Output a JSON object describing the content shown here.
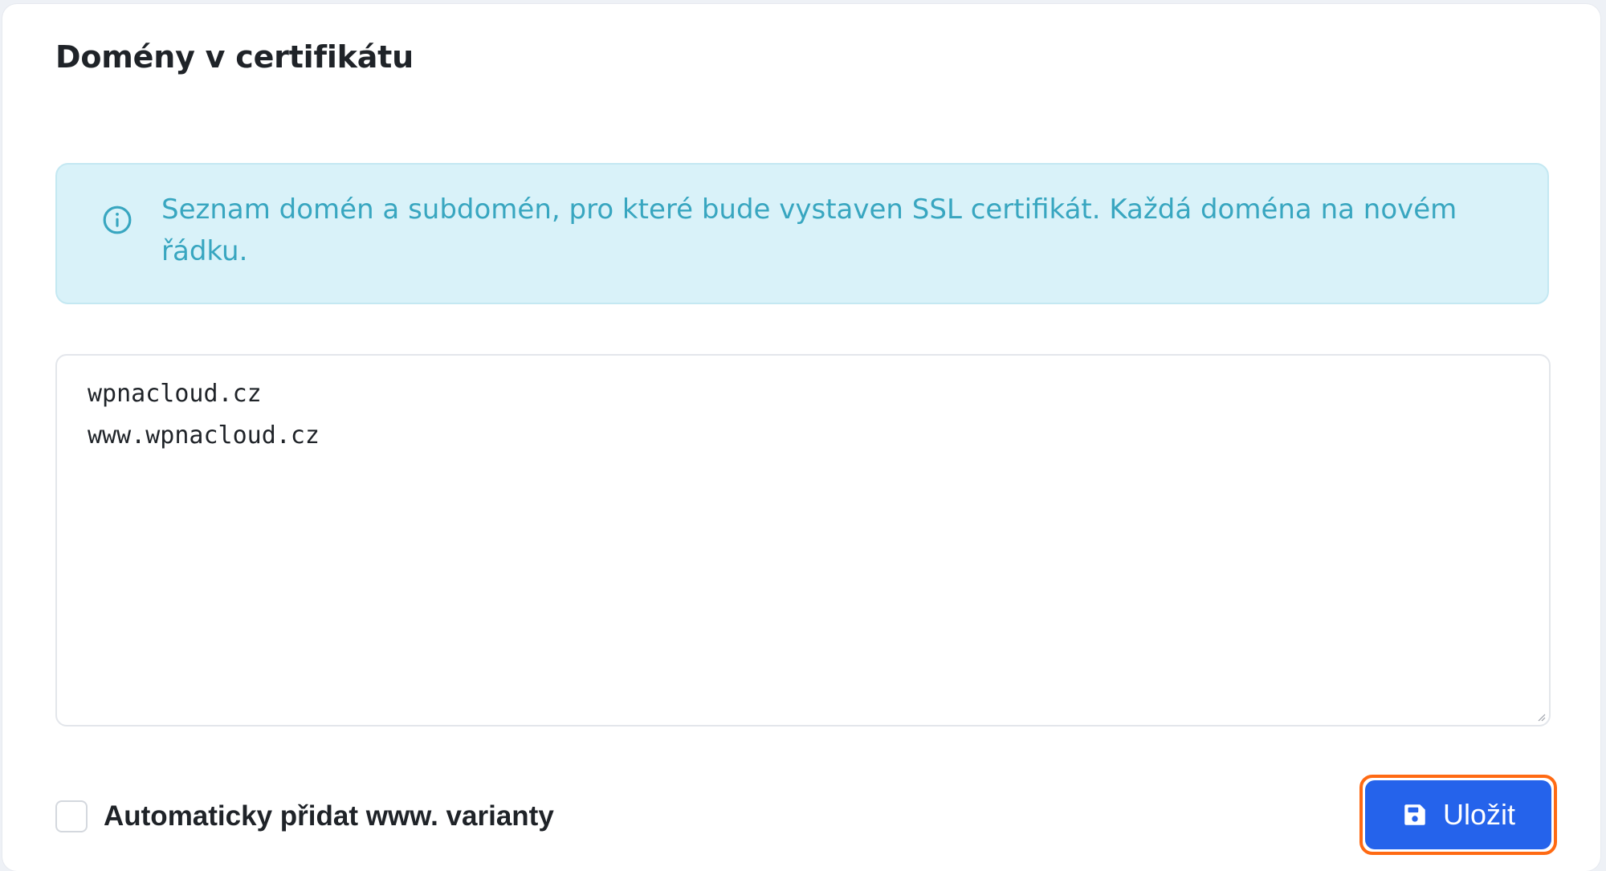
{
  "card": {
    "title": "Domény v certifikátu"
  },
  "alert": {
    "icon": "info-circle-icon",
    "text": "Seznam domén a subdomén, pro které bude vystaven SSL certifikát. Každá doména na novém řádku."
  },
  "domains_field": {
    "value": "wpnacloud.cz\nwww.wpnacloud.cz"
  },
  "auto_www": {
    "label": "Automaticky přidat www. varianty",
    "checked": false
  },
  "save_button": {
    "icon": "floppy-disk-icon",
    "label": "Uložit"
  },
  "colors": {
    "primary": "#2563eb",
    "alert_background": "#d9f2f9",
    "alert_text": "#38a6c0",
    "focus_ring": "#ff6a13"
  }
}
